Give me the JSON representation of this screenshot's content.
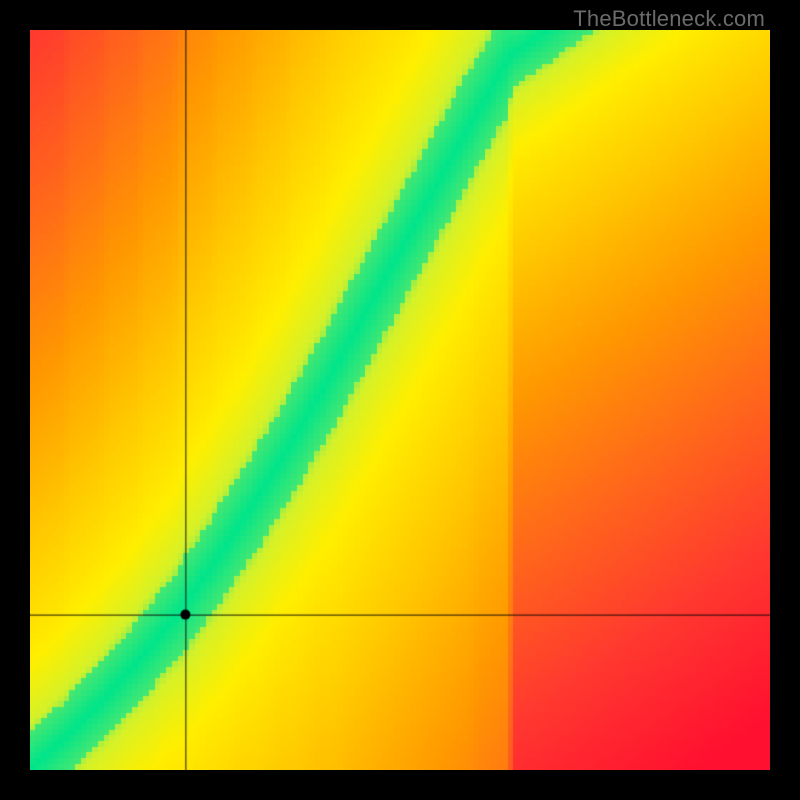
{
  "watermark": "TheBottleneck.com",
  "chart_data": {
    "type": "heatmap",
    "title": "",
    "xlabel": "",
    "ylabel": "",
    "xlim": [
      0,
      1
    ],
    "ylim": [
      0,
      1
    ],
    "marker": {
      "x": 0.21,
      "y": 0.21
    },
    "crosshair": {
      "x": 0.21,
      "y": 0.21
    },
    "optimal_curve_description": "Green band along a superlinear curve from bottom-left to upper-right; surrounding gradient transitions yellow → orange → red with distance from the band.",
    "optimal_curve_samples": [
      {
        "x": 0.0,
        "y": 0.0
      },
      {
        "x": 0.05,
        "y": 0.045
      },
      {
        "x": 0.1,
        "y": 0.095
      },
      {
        "x": 0.15,
        "y": 0.15
      },
      {
        "x": 0.2,
        "y": 0.21
      },
      {
        "x": 0.25,
        "y": 0.28
      },
      {
        "x": 0.3,
        "y": 0.355
      },
      {
        "x": 0.35,
        "y": 0.435
      },
      {
        "x": 0.4,
        "y": 0.52
      },
      {
        "x": 0.45,
        "y": 0.61
      },
      {
        "x": 0.5,
        "y": 0.7
      },
      {
        "x": 0.55,
        "y": 0.79
      },
      {
        "x": 0.6,
        "y": 0.88
      },
      {
        "x": 0.65,
        "y": 0.965
      },
      {
        "x": 0.7,
        "y": 1.0
      }
    ],
    "color_stops": [
      {
        "t": 0.0,
        "color": "#00e58b"
      },
      {
        "t": 0.08,
        "color": "#5ce86a"
      },
      {
        "t": 0.15,
        "color": "#d4f22a"
      },
      {
        "t": 0.25,
        "color": "#ffef00"
      },
      {
        "t": 0.4,
        "color": "#ffc800"
      },
      {
        "t": 0.55,
        "color": "#ff9a00"
      },
      {
        "t": 0.7,
        "color": "#ff6a1a"
      },
      {
        "t": 0.85,
        "color": "#ff3a2f"
      },
      {
        "t": 1.0,
        "color": "#ff1030"
      }
    ],
    "grid_resolution": 130,
    "band_half_width": 0.037
  }
}
